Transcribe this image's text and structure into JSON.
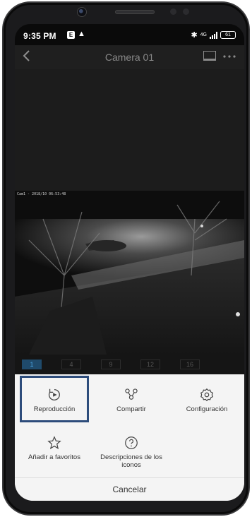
{
  "status_bar": {
    "time": "9:35 PM",
    "notif": "E",
    "warn": "▲",
    "bluetooth": "✱",
    "net": "4G",
    "battery": "61"
  },
  "header": {
    "title": "Camera 01",
    "back_icon": "chevron-left-icon",
    "screen_icon": "screen-icon",
    "more_icon": "more-icon"
  },
  "video": {
    "timestamp": "Cam1 - 2018/10 06:53:48"
  },
  "channels": [
    {
      "label": "1",
      "active": true
    },
    {
      "label": "4",
      "active": false
    },
    {
      "label": "9",
      "active": false
    },
    {
      "label": "12",
      "active": false
    },
    {
      "label": "16",
      "active": false
    }
  ],
  "menu": {
    "playback": "Reproducción",
    "share": "Compartir",
    "settings": "Configuración",
    "favorites": "Añadir a favoritos",
    "icon_desc_line1": "Descripciones de los",
    "icon_desc_line2": "iconos",
    "cancel": "Cancelar"
  }
}
